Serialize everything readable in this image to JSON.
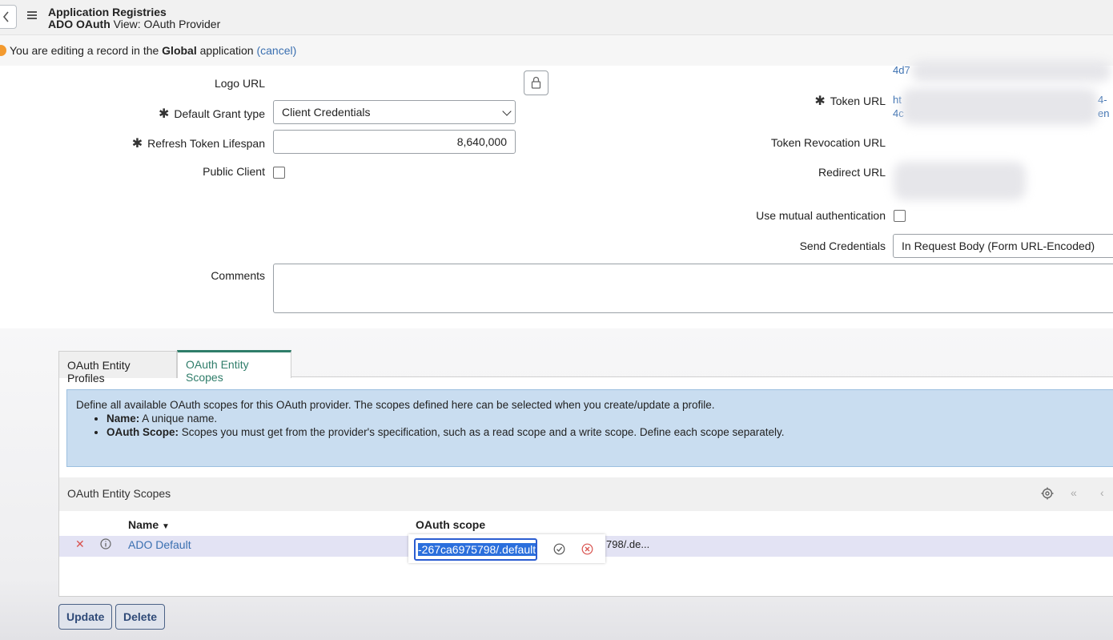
{
  "header": {
    "title": "Application Registries",
    "record_name": "ADO OAuth",
    "view_label": "View: OAuth Provider"
  },
  "notice": {
    "prefix": "You are editing a record in the",
    "scope": "Global",
    "suffix": "application",
    "cancel": "(cancel)"
  },
  "form": {
    "logo_url_label": "Logo URL",
    "grant_type_label": "Default Grant type",
    "grant_type_value": "Client Credentials",
    "refresh_label": "Refresh Token Lifespan",
    "refresh_value": "8,640,000",
    "public_client_label": "Public Client",
    "comments_label": "Comments",
    "token_url_label": "Token URL",
    "token_url_fragments": [
      "4d7",
      "ht",
      "4c",
      "4-",
      "en"
    ],
    "token_revocation_label": "Token Revocation URL",
    "redirect_label": "Redirect URL",
    "mutual_auth_label": "Use mutual authentication",
    "send_credentials_label": "Send Credentials",
    "send_credentials_value": "In Request Body (Form URL-Encoded)"
  },
  "tabs": [
    {
      "label": "OAuth Entity Profiles"
    },
    {
      "label": "OAuth Entity Scopes"
    }
  ],
  "info": {
    "intro": "Define all available OAuth scopes for this OAuth provider. The scopes defined here can be selected when you create/update a profile.",
    "items": [
      {
        "term": "Name:",
        "desc": "A unique name."
      },
      {
        "term": "OAuth Scope:",
        "desc": "Scopes you must get from the provider's specification, such as a read scope and a write scope. Define each scope separately."
      }
    ]
  },
  "list": {
    "title": "OAuth Entity Scopes",
    "columns": [
      "Name",
      "OAuth scope"
    ],
    "row": {
      "name": "ADO Default",
      "edit_value": "-267ca6975798/.default",
      "scope_tail": "798/.de..."
    }
  },
  "buttons": {
    "update": "Update",
    "delete": "Delete"
  },
  "colors": {
    "accent": "#2f7d6a",
    "link": "#3a6fb0",
    "info_bg": "#c9ddf0",
    "notice_dot": "#f39a2f"
  }
}
